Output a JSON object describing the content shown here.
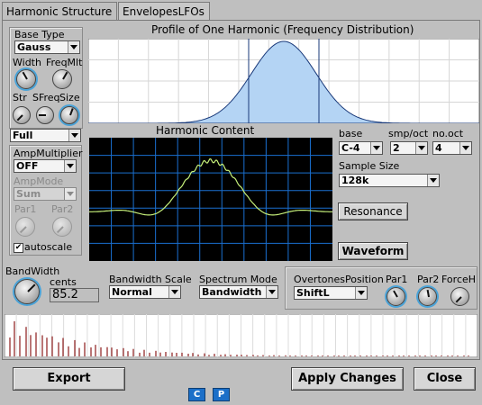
{
  "tabs": [
    {
      "label": "Harmonic Structure",
      "active": true
    },
    {
      "label": "EnvelopesLFOs",
      "active": false
    }
  ],
  "base_type": {
    "label": "Base Type",
    "value": "Gauss"
  },
  "knobs_top": {
    "width": "Width",
    "freqmlt": "FreqMlt",
    "str": "Str",
    "sfreq": "SFreq",
    "size": "Size"
  },
  "mode": {
    "value": "Full"
  },
  "amp": {
    "multiplier_label": "AmpMultiplier",
    "multiplier_value": "OFF",
    "mode_label": "AmpMode",
    "mode_value": "Sum",
    "par1": "Par1",
    "par2": "Par2",
    "autoscale": "autoscale",
    "autoscale_checked": true
  },
  "profile": {
    "title": "Profile of One Harmonic (Frequency Distribution)"
  },
  "harmonic": {
    "title": "Harmonic Content"
  },
  "right": {
    "base_label": "base",
    "base_value": "C-4",
    "smp_label": "smp/oct",
    "smp_value": "2",
    "nooct_label": "no.oct",
    "nooct_value": "4",
    "sample_size_label": "Sample Size",
    "sample_size_value": "128k",
    "resonance": "Resonance",
    "waveform": "Waveform"
  },
  "bandwidth": {
    "label": "BandWidth",
    "cents_label": "cents",
    "value": "85.2"
  },
  "bw_scale": {
    "label": "Bandwidth Scale",
    "value": "Normal"
  },
  "spectrum_mode": {
    "label": "Spectrum Mode",
    "value": "Bandwidth"
  },
  "overtones": {
    "label": "OvertonesPosition",
    "value": "ShiftL",
    "par1": "Par1",
    "par2": "Par2",
    "forceh": "ForceH"
  },
  "bottom": {
    "export": "Export",
    "apply": "Apply Changes",
    "close": "Close",
    "c": "C",
    "p": "P"
  },
  "colors": {
    "plot_fill": "#b4d4f4",
    "scope_bg": "#000000",
    "scope_grid": "#1a6fd0",
    "scope_wave": "#c6f07a",
    "spectrum": "#8b1a1a"
  }
}
